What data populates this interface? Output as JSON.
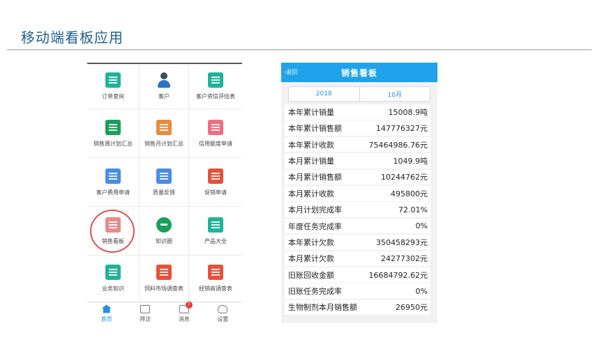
{
  "slide": {
    "title": "移动端看板应用"
  },
  "app_grid": {
    "items": [
      {
        "label": "订单查询",
        "icon": "order-query-icon",
        "color": "teal"
      },
      {
        "label": "客户",
        "icon": "customer-icon",
        "color": "person"
      },
      {
        "label": "客户资信评估表",
        "icon": "credit-assessment-icon",
        "color": "teal"
      },
      {
        "label": "销售周计划汇总",
        "icon": "weekly-plan-icon",
        "color": "green"
      },
      {
        "label": "销售月计划汇总",
        "icon": "monthly-plan-icon",
        "color": "orange"
      },
      {
        "label": "信用额度申请",
        "icon": "credit-limit-icon",
        "color": "pink"
      },
      {
        "label": "客户费用申请",
        "icon": "expense-request-icon",
        "color": "blue"
      },
      {
        "label": "质量反馈",
        "icon": "quality-feedback-icon",
        "color": "blue"
      },
      {
        "label": "促销申请",
        "icon": "promotion-request-icon",
        "color": "red"
      },
      {
        "label": "销售看板",
        "icon": "sales-board-icon",
        "color": "pink",
        "highlighted": true
      },
      {
        "label": "知识圈",
        "icon": "knowledge-circle-icon",
        "color": "green"
      },
      {
        "label": "产品大全",
        "icon": "product-catalog-icon",
        "color": "teal"
      },
      {
        "label": "业务知识",
        "icon": "business-knowledge-icon",
        "color": "teal"
      },
      {
        "label": "饲料市场调查表",
        "icon": "feed-market-survey-icon",
        "color": "red"
      },
      {
        "label": "经销商调查表",
        "icon": "dealer-survey-icon",
        "color": "red"
      }
    ]
  },
  "tabbar": {
    "items": [
      {
        "label": "首页",
        "icon": "home-icon",
        "active": true
      },
      {
        "label": "拜访",
        "icon": "briefcase-icon"
      },
      {
        "label": "消息",
        "icon": "message-icon",
        "badge": "7"
      },
      {
        "label": "设置",
        "icon": "settings-user-icon"
      }
    ]
  },
  "sales_board": {
    "back_label": "返回",
    "title": "销售看板",
    "year": "2018",
    "month": "10月",
    "metrics": [
      {
        "label": "本年累计销量",
        "value": "15008.9吨"
      },
      {
        "label": "本年累计销售额",
        "value": "147776327元"
      },
      {
        "label": "本年累计收款",
        "value": "75464986.76元"
      },
      {
        "label": "本月累计销量",
        "value": "1049.9吨"
      },
      {
        "label": "本月累计销售额",
        "value": "10244762元"
      },
      {
        "label": "本月累计收款",
        "value": "495800元"
      },
      {
        "label": "本月计划完成率",
        "value": "72.01%"
      },
      {
        "label": "年度任务完成率",
        "value": "0%"
      },
      {
        "label": "本年累计欠款",
        "value": "350458293元"
      },
      {
        "label": "本月累计欠款",
        "value": "24277302元"
      },
      {
        "label": "旧账回收金额",
        "value": "16684792.62元"
      },
      {
        "label": "旧账任务完成率",
        "value": "0%"
      },
      {
        "label": "生物制剂本月销售额",
        "value": "26950元"
      }
    ]
  }
}
